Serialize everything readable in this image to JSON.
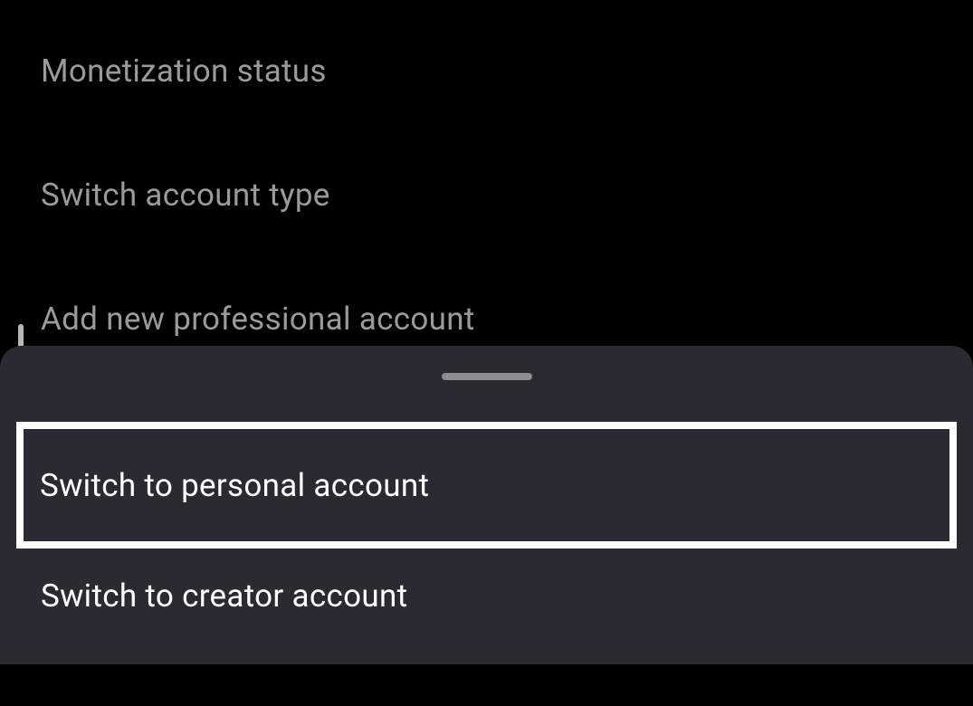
{
  "settings": {
    "items": [
      {
        "label": "Monetization status"
      },
      {
        "label": "Switch account type"
      },
      {
        "label": "Add new professional account"
      }
    ]
  },
  "sheet": {
    "options": [
      {
        "label": "Switch to personal account"
      },
      {
        "label": "Switch to creator account"
      }
    ]
  }
}
